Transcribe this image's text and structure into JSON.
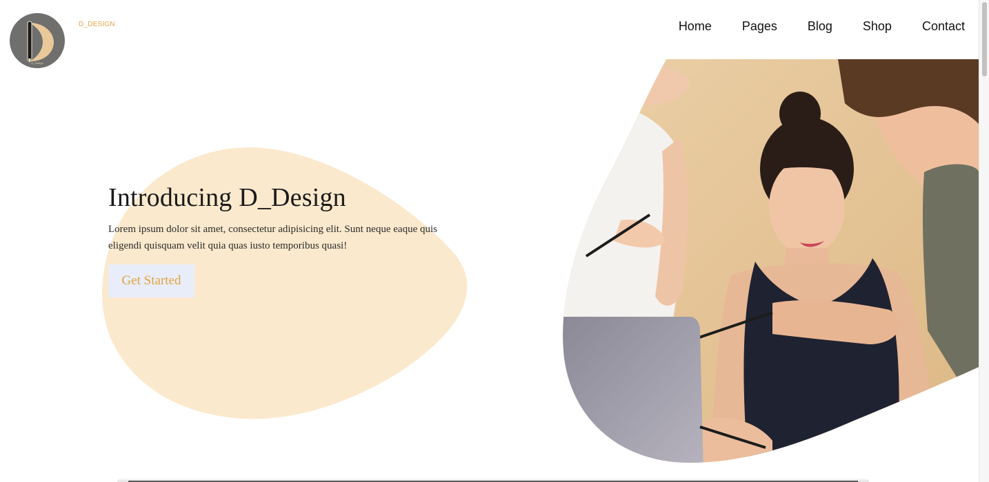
{
  "header": {
    "brand": "D_DESIGN",
    "logo_text": "D_Design",
    "nav": [
      "Home",
      "Pages",
      "Blog",
      "Shop",
      "Contact"
    ]
  },
  "hero": {
    "title": "Introducing D_Design",
    "text": "Lorem ipsum dolor sit amet, consectetur adipisicing elit. Sunt neque eaque quis eligendi quisquam velit quia quas iusto temporibus quasi!",
    "cta_label": "Get Started"
  },
  "colors": {
    "blob": "#fbe9cd",
    "accent": "#e3a54a",
    "cta_bg": "#e9edf9",
    "logo_bg": "#6f6f6d"
  }
}
